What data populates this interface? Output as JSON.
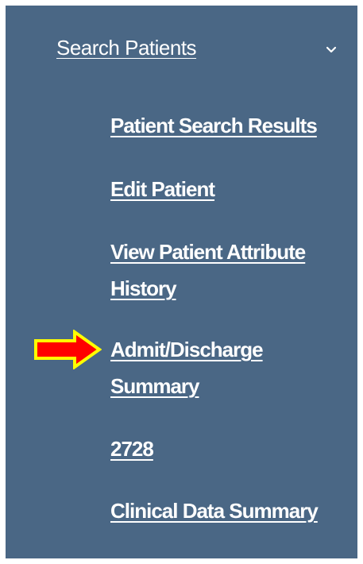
{
  "nav": {
    "search_patients": "Search Patients",
    "items": [
      {
        "label": "Patient Search Results"
      },
      {
        "label": "Edit Patient"
      },
      {
        "label": "View Patient Attribute History"
      },
      {
        "label": "Admit/Discharge Summary"
      },
      {
        "label": "2728"
      },
      {
        "label": "Clinical Data Summary"
      }
    ]
  },
  "icons": {
    "expand": "chevron-down-icon",
    "pointer": "arrow-right-icon"
  },
  "colors": {
    "panel_background": "#4a6785",
    "link_text": "#ffffff",
    "arrow_fill": "#ff0000",
    "arrow_outline": "#ffff00"
  }
}
